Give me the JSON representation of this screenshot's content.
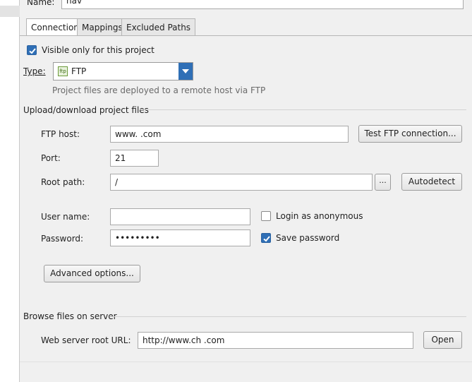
{
  "left_strip": {},
  "name_field": {
    "label": "Name:",
    "value": "nav"
  },
  "tabs": [
    {
      "label": "Connection",
      "active": true
    },
    {
      "label": "Mappings",
      "active": false
    },
    {
      "label": "Excluded Paths",
      "active": false
    }
  ],
  "visible_only": {
    "label": "Visible only for this project",
    "checked": true
  },
  "type": {
    "label": "Type:",
    "value": "FTP",
    "icon": "ftp-icon",
    "description": "Project files are deployed to a remote host via FTP"
  },
  "upload_section": {
    "title": "Upload/download project files"
  },
  "ftp_host": {
    "label": "FTP host:",
    "value": "www.          .com",
    "test_button": "Test FTP connection..."
  },
  "port": {
    "label": "Port:",
    "value": "21"
  },
  "root_path": {
    "label": "Root path:",
    "value": "/",
    "browse_button": "...",
    "autodetect_button": "Autodetect"
  },
  "user_name": {
    "label": "User name:",
    "value": ""
  },
  "anonymous": {
    "label": "Login as anonymous",
    "checked": false
  },
  "password": {
    "label": "Password:",
    "value": "•••••••••"
  },
  "save_password": {
    "label": "Save password",
    "checked": true
  },
  "advanced_button": "Advanced options...",
  "browse_section": {
    "title": "Browse files on server"
  },
  "web_root": {
    "label": "Web server root URL:",
    "value": "http://www.ch              .com",
    "open_button": "Open"
  },
  "colors": {
    "accent": "#2f6fb6",
    "panel_bg": "#f0f0f0",
    "field_border": "#a9a9a9"
  }
}
